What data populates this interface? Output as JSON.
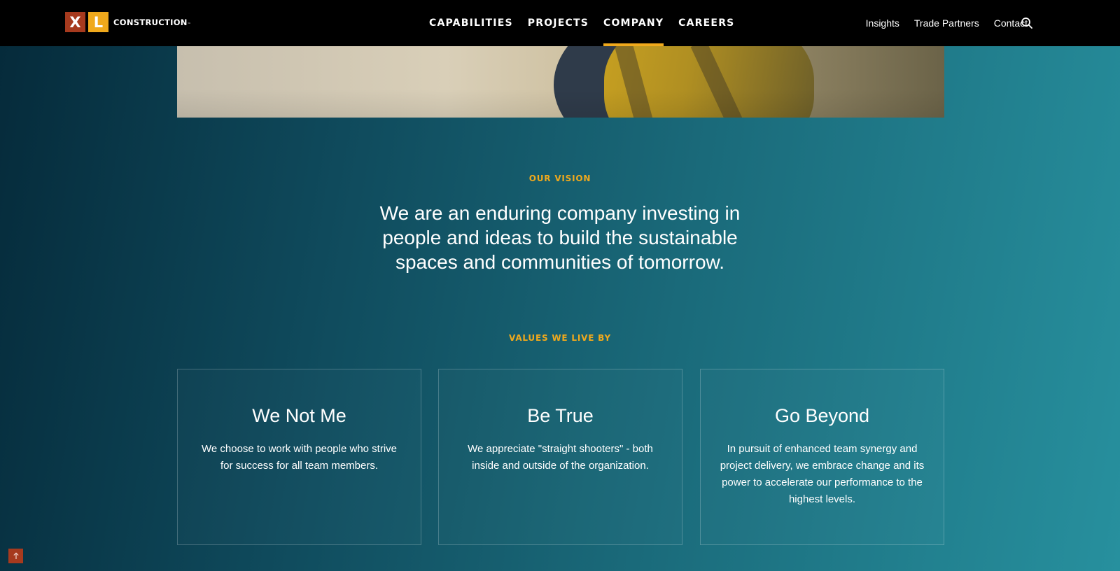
{
  "brand": {
    "logo_x": "X",
    "logo_l": "L",
    "name": "CONSTRUCTION",
    "tm": "™",
    "colors": {
      "red": "#a63a1e",
      "gold": "#f0a91c",
      "header_bg": "#000000"
    }
  },
  "nav": {
    "main": [
      {
        "label": "CAPABILITIES",
        "active": false
      },
      {
        "label": "PROJECTS",
        "active": false
      },
      {
        "label": "COMPANY",
        "active": true
      },
      {
        "label": "CAREERS",
        "active": false
      }
    ],
    "utility": [
      {
        "label": "Insights"
      },
      {
        "label": "Trade Partners"
      },
      {
        "label": "Contact"
      }
    ],
    "search_icon": "search-icon"
  },
  "vision": {
    "eyebrow": "OUR VISION",
    "text": "We are an enduring company investing in people and ideas to build the sustainable spaces and communities of tomorrow."
  },
  "values": {
    "eyebrow": "VALUES WE LIVE BY",
    "cards": [
      {
        "title": "We Not Me",
        "body": "We choose to work with people who strive for success for all team members."
      },
      {
        "title": "Be True",
        "body": "We appreciate \"straight shooters\" - both inside and outside of the organization."
      },
      {
        "title": "Go Beyond",
        "body": "In pursuit of enhanced team synergy and project delivery, we embrace change and its power to accelerate our performance to the highest levels."
      }
    ]
  },
  "back_to_top_icon": "arrow-up-icon"
}
